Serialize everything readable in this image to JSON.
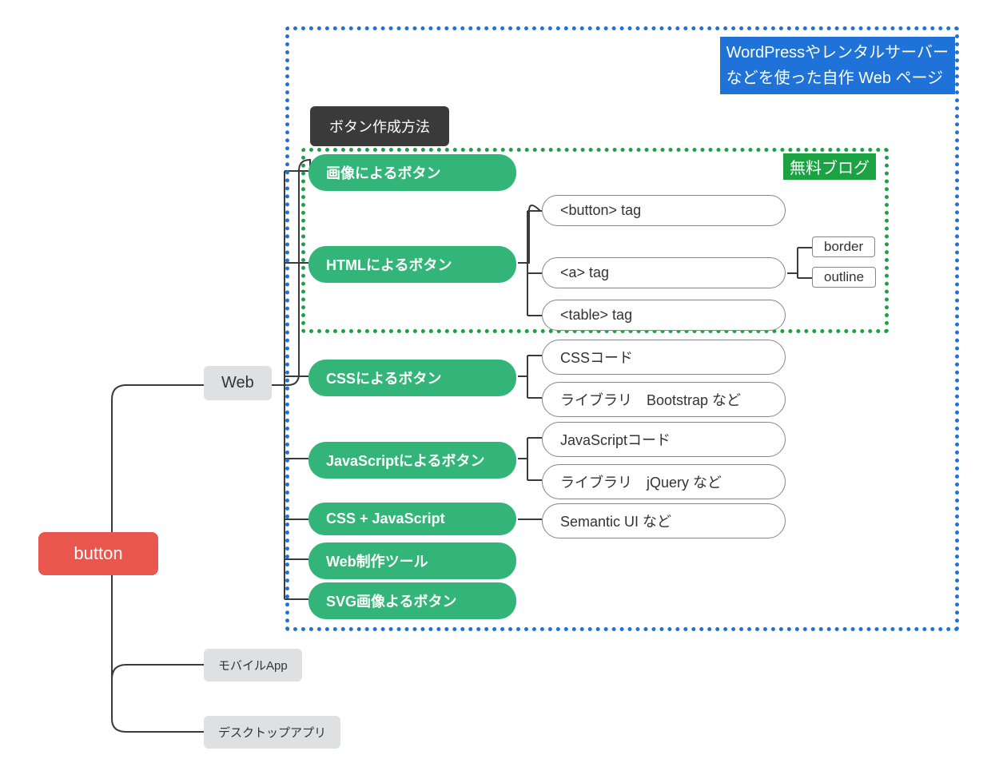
{
  "root": {
    "label": "button"
  },
  "level1": {
    "web": "Web",
    "mobile": "モバイルApp",
    "desktop": "デスクトップアプリ"
  },
  "header_label": "ボタン作成方法",
  "blue_badge_line1": "WordPressやレンタルサーバー",
  "blue_badge_line2": "などを使った自作 Web ページ",
  "green_badge": "無料ブログ",
  "methods": {
    "image": "画像によるボタン",
    "html": "HTMLによるボタン",
    "css": "CSSによるボタン",
    "js": "JavaScriptによるボタン",
    "cssjs": "CSS + JavaScript",
    "tool": "Web制作ツール",
    "svg": "SVG画像よるボタン"
  },
  "html_children": {
    "button_tag": "<button> tag",
    "a_tag": "<a> tag",
    "table_tag": "<table> tag"
  },
  "a_children": {
    "border": "border",
    "outline": "outline"
  },
  "css_children": {
    "code": "CSSコード",
    "lib": "ライブラリ　Bootstrap など"
  },
  "js_children": {
    "code": "JavaScriptコード",
    "lib": "ライブラリ　jQuery など"
  },
  "cssjs_children": {
    "semantic": "Semantic UI など"
  },
  "colors": {
    "root": "#e8564d",
    "gray": "#dee0e1",
    "green_node": "#33b579",
    "blue_dash": "#1f73d8",
    "green_dash": "#1aa243",
    "dark": "#3a3a3a"
  }
}
